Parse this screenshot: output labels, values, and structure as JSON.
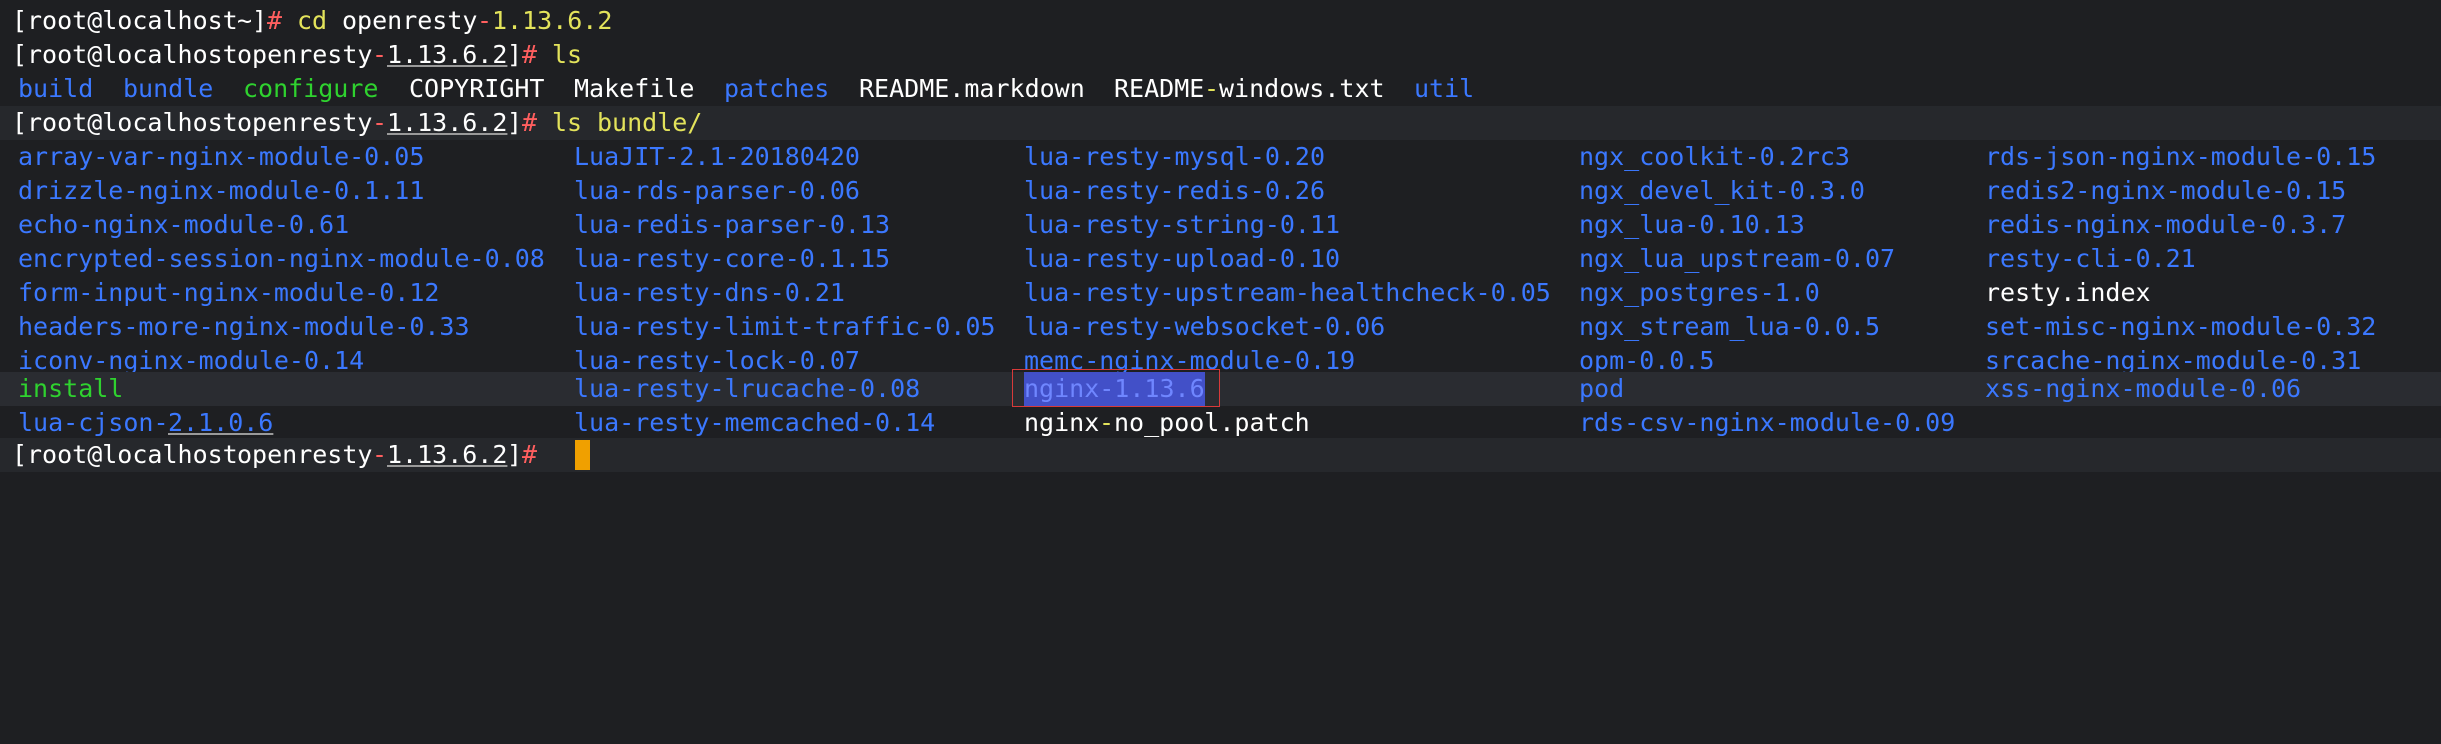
{
  "prompt": {
    "user_host": "root@localhost",
    "dir_home": "~",
    "dir_openresty": "openresty-1.13.6.2",
    "dir_openresty_name": "openresty",
    "dir_openresty_sep": "-",
    "dir_openresty_ver": "1.13.6.2"
  },
  "commands": {
    "cd_name": "cd",
    "cd_arg_name": "openresty",
    "cd_arg_sep": "-",
    "cd_arg_ver": "1.13.6.2",
    "ls": "ls",
    "ls_bundle_name": "ls",
    "ls_bundle_arg": "bundle/"
  },
  "listing_root": [
    {
      "name": "build",
      "type": "dir"
    },
    {
      "name": "bundle",
      "type": "dir"
    },
    {
      "name": "configure",
      "type": "exec"
    },
    {
      "name": "COPYRIGHT",
      "type": "file"
    },
    {
      "name": "Makefile",
      "type": "file"
    },
    {
      "name": "patches",
      "type": "dir"
    },
    {
      "name": "README.markdown",
      "type": "file"
    },
    {
      "name": "README-windows.txt",
      "type": "file"
    },
    {
      "name": "util",
      "type": "dir"
    }
  ],
  "bundle": {
    "col1": [
      "array-var-nginx-module-0.05",
      "drizzle-nginx-module-0.1.11",
      "echo-nginx-module-0.61",
      "encrypted-session-nginx-module-0.08",
      "form-input-nginx-module-0.12",
      "headers-more-nginx-module-0.33",
      "iconv-nginx-module-0.14",
      "install",
      "lua-cjson-2.1.0.6"
    ],
    "col2": [
      "LuaJIT-2.1-20180420",
      "lua-rds-parser-0.06",
      "lua-redis-parser-0.13",
      "lua-resty-core-0.1.15",
      "lua-resty-dns-0.21",
      "lua-resty-limit-traffic-0.05",
      "lua-resty-lock-0.07",
      "lua-resty-lrucache-0.08",
      "lua-resty-memcached-0.14"
    ],
    "col3": [
      "lua-resty-mysql-0.20",
      "lua-resty-redis-0.26",
      "lua-resty-string-0.11",
      "lua-resty-upload-0.10",
      "lua-resty-upstream-healthcheck-0.05",
      "lua-resty-websocket-0.06",
      "memc-nginx-module-0.19",
      "nginx-1.13.6",
      "nginx-no_pool.patch"
    ],
    "col4": [
      "ngx_coolkit-0.2rc3",
      "ngx_devel_kit-0.3.0",
      "ngx_lua-0.10.13",
      "ngx_lua_upstream-0.07",
      "ngx_postgres-1.0",
      "ngx_stream_lua-0.0.5",
      "opm-0.0.5",
      "pod",
      "rds-csv-nginx-module-0.09"
    ],
    "col5": [
      "rds-json-nginx-module-0.15",
      "redis2-nginx-module-0.15",
      "redis-nginx-module-0.3.7",
      "resty-cli-0.21",
      "resty.index",
      "set-misc-nginx-module-0.32",
      "srcache-nginx-module-0.31",
      "xss-nginx-module-0.06"
    ]
  },
  "colors": {
    "background": "#1e1f22",
    "dir_blue": "#3b78ff",
    "exec_green": "#2fd22f",
    "prompt_red": "#ff5f5f",
    "cmd_yellow": "#e3e35b",
    "cursor": "#f0a000",
    "selection_box": "#d83a3a"
  }
}
